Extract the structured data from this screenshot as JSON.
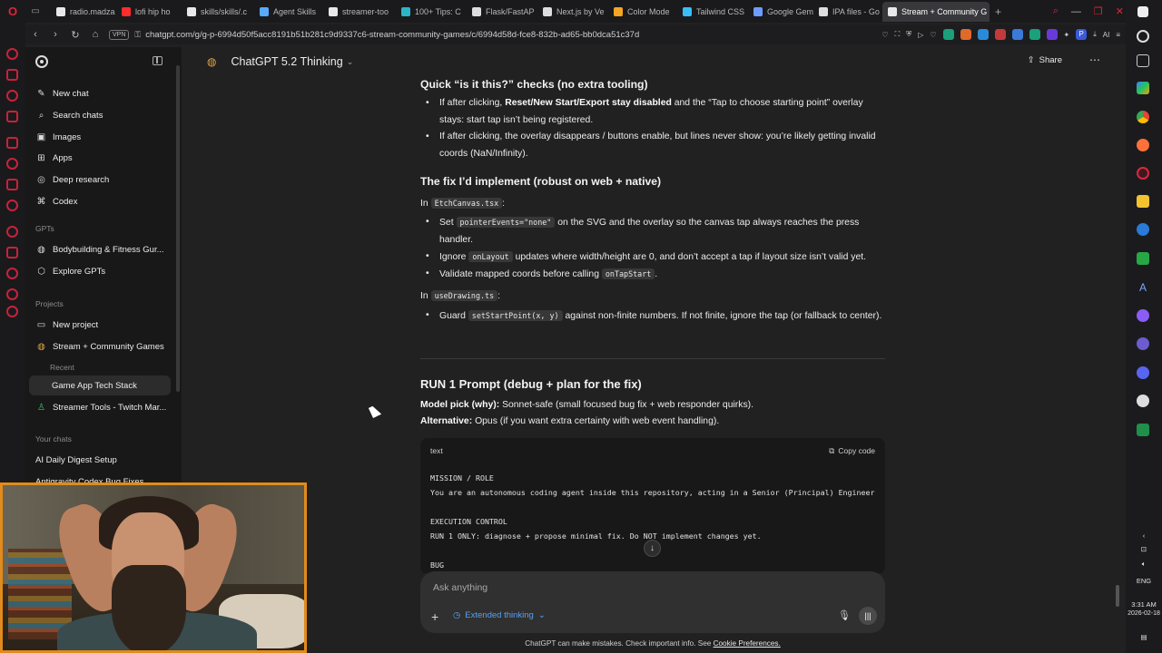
{
  "browser": {
    "tabs": [
      {
        "label": "radio.madza",
        "color": "#e8e8e8"
      },
      {
        "label": "lofi hip ho",
        "color": "#ff2d2d"
      },
      {
        "label": "skills/skills/.c",
        "color": "#e8e8e8"
      },
      {
        "label": "Agent Skills",
        "color": "#5aa9ff"
      },
      {
        "label": "streamer-too",
        "color": "#e8e8e8"
      },
      {
        "label": "100+ Tips: C",
        "color": "#2bb5c9"
      },
      {
        "label": "Flask/FastAP",
        "color": "#dddddd"
      },
      {
        "label": "Next.js by Ve",
        "color": "#dddddd"
      },
      {
        "label": "Color Mode",
        "color": "#f5a623"
      },
      {
        "label": "Tailwind CSS",
        "color": "#38bdf8"
      },
      {
        "label": "Google Gemi",
        "color": "#6f9cff"
      },
      {
        "label": "IPA files - Go",
        "color": "#dddddd"
      },
      {
        "label": "Stream + Community G",
        "color": "#e8e8e8"
      }
    ],
    "url": "chatgpt.com/g/g-p-6994d50f5acc8191b51b281c9d9337c6-stream-community-games/c/6994d58d-fce8-832b-ad65-bb0dca51c37d",
    "vpn_label": "VPN",
    "ai_label": "AI"
  },
  "sidebar": {
    "items": [
      {
        "label": "New chat",
        "icon": "✎"
      },
      {
        "label": "Search chats",
        "icon": "⌕"
      },
      {
        "label": "Images",
        "icon": "▣"
      },
      {
        "label": "Apps",
        "icon": "⊞"
      },
      {
        "label": "Deep research",
        "icon": "◎"
      },
      {
        "label": "Codex",
        "icon": "⌘"
      }
    ],
    "gpts_heading": "GPTs",
    "gpts": [
      {
        "label": "Bodybuilding & Fitness Gur...",
        "icon": "◍"
      },
      {
        "label": "Explore GPTs",
        "icon": "⬡"
      }
    ],
    "projects_heading": "Projects",
    "projects": [
      {
        "label": "New project",
        "icon": "▭"
      },
      {
        "label": "Stream + Community Games",
        "icon": "◍"
      }
    ],
    "recent_label": "Recent",
    "recent_item": "Game App Tech Stack",
    "streamer_tools": "Streamer Tools - Twitch Mar...",
    "chats_heading": "Your chats",
    "chats": [
      "AI Daily Digest Setup",
      "Antigravity Codex Bug Fixes"
    ]
  },
  "header": {
    "model_name": "ChatGPT 5.2 Thinking",
    "share_label": "Share"
  },
  "content": {
    "h_quick": "Quick “is it this?” checks (no extra tooling)",
    "quick_bullets": [
      {
        "pre": "If after clicking, ",
        "bold": "Reset/New Start/Export stay disabled",
        "post": " and the “Tap to choose starting point” overlay stays: start tap isn’t being registered."
      },
      {
        "pre": "If after clicking, the overlay disappears / buttons enable, but lines never show: you’re likely getting invalid coords (NaN/Infinity).",
        "bold": "",
        "post": ""
      }
    ],
    "h_fix": "The fix I’d implement (robust on web + native)",
    "in_label": "In",
    "file_etch": "EtchCanvas.tsx",
    "etch_b1_pre": "Set",
    "etch_b1_code": "pointerEvents=\"none\"",
    "etch_b1_post": "on the SVG and the overlay so the canvas tap always reaches the press handler.",
    "etch_b2_pre": "Ignore",
    "etch_b2_code": "onLayout",
    "etch_b2_post": "updates where width/height are 0, and don’t accept a tap if layout size isn’t valid yet.",
    "etch_b3_pre": "Validate mapped coords before calling",
    "etch_b3_code": "onTapStart",
    "file_use": "useDrawing.ts",
    "use_b1_pre": "Guard",
    "use_b1_code": "setStartPoint(x, y)",
    "use_b1_post": "against non-finite numbers. If not finite, ignore the tap (or fallback to center).",
    "h_run": "RUN 1 Prompt (debug + plan for the fix)",
    "model_pick_label": "Model pick (why):",
    "model_pick_text": "Sonnet-safe (small focused bug fix + web responder quirks).",
    "alt_label": "Alternative:",
    "alt_text": "Opus (if you want extra certainty with web event handling)."
  },
  "code": {
    "lang": "text",
    "copy_label": "Copy code",
    "lines": [
      "MISSION / ROLE",
      "You are an autonomous coding agent inside this repository, acting in a Senior (Principal) Engineer",
      "EXECUTION CONTROL",
      "RUN 1 ONLY: diagnose + propose minimal fix. Do NOT implement changes yet.",
      "BUG"
    ]
  },
  "composer": {
    "placeholder": "Ask anything",
    "extended_label": "Extended thinking"
  },
  "footer": {
    "text": "ChatGPT can make mistakes. Check important info. See",
    "link": "Cookie Preferences."
  },
  "taskbar": {
    "lang": "ENG",
    "time": "3:31 AM",
    "date": "2026-02-18"
  }
}
